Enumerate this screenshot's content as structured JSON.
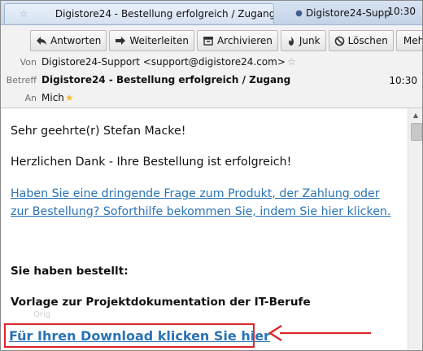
{
  "tabs": [
    {
      "title": "Digistore24 - Bestellung erfolgreich / Zugang",
      "active": true
    },
    {
      "title": "Digistore24-Supp...",
      "active": false
    }
  ],
  "clock": "10:30",
  "toolbar": {
    "reply": "Antworten",
    "forward": "Weiterleiten",
    "archive": "Archivieren",
    "junk": "Junk",
    "delete": "Löschen",
    "more": "Mehr"
  },
  "header": {
    "from_label": "Von",
    "from_value": "Digistore24-Support <support@digistore24.com>",
    "subject_label": "Betreff",
    "subject_value": "Digistore24 - Bestellung erfolgreich / Zugang",
    "time": "10:30",
    "to_label": "An",
    "to_value": "Mich"
  },
  "body": {
    "greeting": "Sehr geehrte(r) Stefan Macke!",
    "thanks": "Herzlichen Dank - Ihre Bestellung ist erfolgreich!",
    "help_link": "Haben Sie eine dringende Frage zum Produkt, der Zahlung oder zur Bestellung? Soforthilfe bekommen Sie, indem Sie hier klicken.",
    "ordered_heading": "Sie haben bestellt:",
    "product": "Vorlage zur Projektdokumentation der IT-Berufe",
    "ghost_text": "Orig",
    "download_link": "Für Ihren Download klicken Sie hier"
  },
  "colors": {
    "link": "#2a73b6",
    "highlight": "#d9262b",
    "tabbar": "#c3d3e8"
  }
}
